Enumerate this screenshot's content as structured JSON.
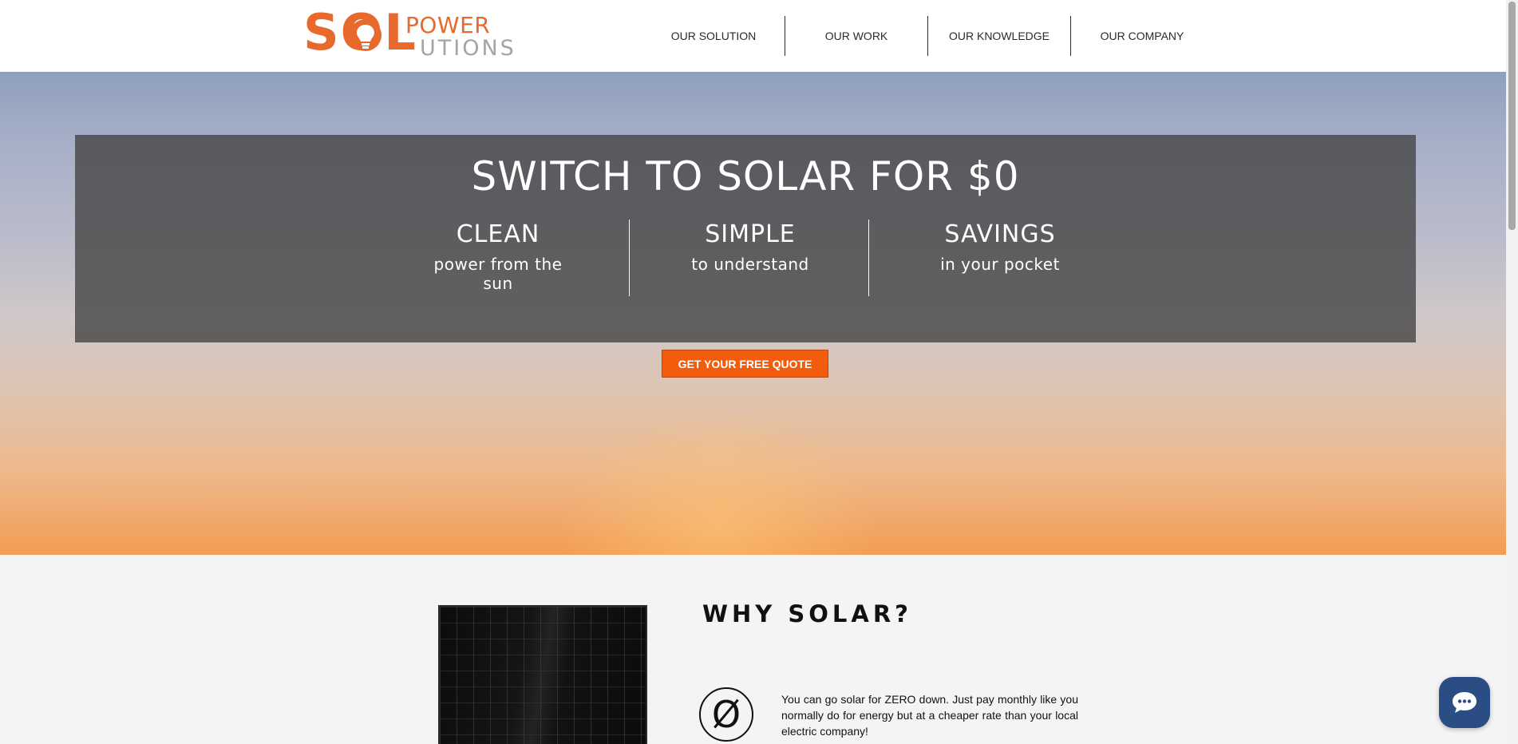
{
  "header": {
    "logo": {
      "sol": "SOL",
      "power": "POWER",
      "utions": "UTIONS"
    },
    "nav": [
      {
        "label": "OUR SOLUTION"
      },
      {
        "label": "OUR WORK"
      },
      {
        "label": "OUR KNOWLEDGE"
      },
      {
        "label": "OUR COMPANY"
      }
    ]
  },
  "hero": {
    "title": "SWITCH TO SOLAR FOR $0",
    "features": [
      {
        "title": "CLEAN",
        "subtitle": "power from the sun"
      },
      {
        "title": "SIMPLE",
        "subtitle": "to understand"
      },
      {
        "title": "SAVINGS",
        "subtitle": "in your pocket"
      }
    ],
    "cta_label": "GET YOUR FREE QUOTE"
  },
  "why_solar": {
    "title": "WHY SOLAR?",
    "zero_symbol": "Ø",
    "text": "You can go solar for ZERO down. Just pay monthly like you normally do for energy but at a cheaper rate than your local electric company!"
  },
  "colors": {
    "brand_orange": "#e8692c",
    "cta_orange": "#f25c0c",
    "logo_gray": "#a4a4a4",
    "chat_blue": "#2a4d84"
  },
  "icons": {
    "logo_bulb": "lightbulb-icon",
    "chat": "chat-bubble-icon"
  }
}
